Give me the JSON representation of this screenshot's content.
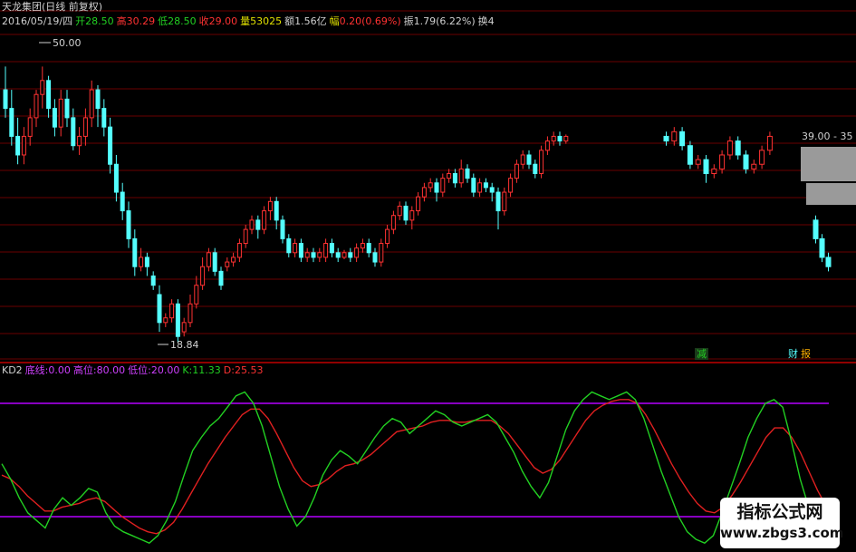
{
  "header": {
    "title": "天龙集团(日线 前复权)",
    "date": "2016/05/19/四",
    "open_label": "开",
    "open": "28.50",
    "high_label": "高",
    "high": "30.29",
    "low_label": "低",
    "low": "28.50",
    "close_label": "收",
    "close": "29.00",
    "vol_label": "量",
    "vol": "53025",
    "amount_label": "额",
    "amount": "1.56亿",
    "change_label": "幅",
    "change": "0.20(0.69%)",
    "amp_label": "振",
    "amp": "1.79(6.22%)",
    "turnover_label": "换",
    "turnover": "4"
  },
  "annotations": {
    "high_mark": "50.00",
    "low_mark": "18.84",
    "range_label": "39.00 - 35",
    "reduce_tag": "减",
    "finance_tag": "财",
    "report_tag": "报"
  },
  "indicator": {
    "name": "KD2",
    "bottom_label": "底线:",
    "bottom": "0.00",
    "top_label": "高位:",
    "top": "80.00",
    "lowpos_label": "低位:",
    "lowpos": "20.00",
    "k_label": "K:",
    "k": "11.33",
    "d_label": "D:",
    "d": "25.53"
  },
  "watermark": {
    "line1": "指标公式网",
    "line2": "www.zbgs3.com"
  },
  "colors": {
    "up": "#ff3232",
    "down": "#54ffff",
    "k_line": "#22d022",
    "d_line": "#e02020",
    "band": "#b400ff",
    "grid": "#6a0000",
    "axis": "#c00000"
  },
  "chart_data": {
    "type": "candlestick",
    "price_high": 50.0,
    "price_low": 18.84,
    "price_range_hint": "39.00 - 35",
    "candles": [
      [
        46,
        44,
        48.5,
        43
      ],
      [
        44,
        41,
        46,
        40
      ],
      [
        41,
        39,
        43,
        38
      ],
      [
        39,
        41,
        42,
        38
      ],
      [
        41,
        43,
        44,
        40
      ],
      [
        43,
        45.5,
        46,
        42
      ],
      [
        45.5,
        47,
        48.5,
        44
      ],
      [
        47,
        44,
        47.5,
        43
      ],
      [
        44,
        42,
        45,
        41
      ],
      [
        42,
        45,
        46,
        41
      ],
      [
        45,
        43,
        46,
        42
      ],
      [
        43,
        40,
        44,
        39.5
      ],
      [
        40,
        41,
        42,
        39
      ],
      [
        41,
        43,
        44,
        40
      ],
      [
        43,
        46,
        47,
        42
      ],
      [
        46,
        44,
        46.5,
        42
      ],
      [
        44,
        42,
        45,
        41
      ],
      [
        42,
        38,
        43,
        37
      ],
      [
        38,
        35,
        39,
        34
      ],
      [
        35,
        33,
        36,
        32
      ],
      [
        33,
        30,
        34,
        29
      ],
      [
        30,
        27,
        31,
        26
      ],
      [
        27,
        28,
        29,
        26.5
      ],
      [
        28,
        27,
        28.5,
        26
      ],
      [
        26,
        25,
        26.5,
        24.5
      ],
      [
        24,
        21,
        25,
        20
      ],
      [
        21,
        21.5,
        22,
        20.5
      ],
      [
        21.5,
        23,
        23.5,
        21
      ],
      [
        23,
        19.5,
        23.5,
        18.84
      ],
      [
        20,
        21,
        21.5,
        19.5
      ],
      [
        21,
        23,
        24,
        20.5
      ],
      [
        23,
        25,
        26,
        22.5
      ],
      [
        25,
        27,
        28,
        24.5
      ],
      [
        27,
        28.5,
        29,
        26.5
      ],
      [
        28.5,
        26.5,
        29,
        26
      ],
      [
        26.5,
        25,
        27,
        24.5
      ],
      [
        27,
        27.5,
        28,
        26.5
      ],
      [
        27.5,
        28,
        28.5,
        27
      ],
      [
        28,
        29.5,
        30,
        27.5
      ],
      [
        29.5,
        31,
        31.5,
        29
      ],
      [
        31,
        32,
        32.5,
        30.5
      ],
      [
        32,
        31,
        32.5,
        30
      ],
      [
        31,
        33,
        33.5,
        30.5
      ],
      [
        33,
        34,
        34.5,
        32
      ],
      [
        34,
        32,
        34.5,
        31
      ],
      [
        32,
        30,
        32.5,
        29.5
      ],
      [
        30,
        28.5,
        30.5,
        28
      ],
      [
        28.5,
        29.5,
        30,
        28
      ],
      [
        29.5,
        28,
        30,
        27.5
      ],
      [
        28,
        28.5,
        29,
        27.5
      ],
      [
        28.5,
        28,
        29,
        27.5
      ],
      [
        28,
        28.5,
        29,
        27.5
      ],
      [
        28,
        29.5,
        30,
        27.5
      ],
      [
        29.5,
        28.5,
        30,
        28
      ],
      [
        28.5,
        28,
        29,
        27.5
      ],
      [
        28,
        28.5,
        28.8,
        27.8
      ],
      [
        28.5,
        28,
        29,
        27.5
      ],
      [
        28,
        29,
        29.5,
        27.5
      ],
      [
        29,
        29.5,
        30,
        28.5
      ],
      [
        29.5,
        28.5,
        30,
        28
      ],
      [
        28.5,
        27.5,
        29,
        27
      ],
      [
        27.5,
        29.5,
        30,
        27
      ],
      [
        29.5,
        31,
        31.5,
        29
      ],
      [
        31,
        32.5,
        33,
        30.5
      ],
      [
        32.5,
        33.5,
        34,
        32
      ],
      [
        33.5,
        32,
        34,
        31.5
      ],
      [
        32,
        33,
        33.5,
        31
      ],
      [
        33,
        34.5,
        35,
        32.5
      ],
      [
        34.5,
        35.5,
        36,
        34
      ],
      [
        35.5,
        36,
        36.5,
        35
      ],
      [
        36,
        35,
        36.5,
        34
      ],
      [
        35,
        36.5,
        37,
        34.5
      ],
      [
        36.5,
        37,
        37.5,
        36
      ],
      [
        37,
        36,
        37.5,
        35.5
      ],
      [
        36,
        37.5,
        38.5,
        35.5
      ],
      [
        37.5,
        36.5,
        38,
        36
      ],
      [
        36.5,
        35,
        37,
        34.5
      ],
      [
        35,
        36,
        36.5,
        34.5
      ],
      [
        36,
        35.5,
        36.5,
        35
      ],
      [
        35.5,
        35,
        36,
        34
      ],
      [
        35,
        33,
        35.5,
        31
      ],
      [
        33,
        35,
        35.5,
        32.5
      ],
      [
        35,
        36.5,
        37,
        34.5
      ],
      [
        36.5,
        38,
        38.5,
        36
      ],
      [
        38,
        39,
        39.5,
        37.5
      ],
      [
        39,
        38,
        39.5,
        37.5
      ],
      [
        38,
        37,
        38.5,
        36.5
      ],
      [
        37,
        39.5,
        40,
        36.5
      ],
      [
        39.5,
        40.5,
        41,
        39
      ],
      [
        40.5,
        41,
        41.5,
        40
      ],
      [
        41,
        40.5,
        41.5,
        40
      ],
      [
        40.5,
        41,
        41.2,
        40.2
      ]
    ],
    "candles_right": [
      [
        41,
        40.5,
        41.5,
        40
      ],
      [
        40.5,
        41.5,
        42,
        40
      ],
      [
        41.5,
        40,
        42,
        39.5
      ],
      [
        40,
        38,
        40.5,
        37.5
      ],
      [
        38,
        38.5,
        39,
        37.5
      ],
      [
        38.5,
        37,
        39,
        36
      ],
      [
        37,
        37.5,
        38,
        36.5
      ],
      [
        37.5,
        39,
        39.5,
        37
      ],
      [
        39,
        40.5,
        41,
        38.5
      ],
      [
        40.5,
        39,
        41,
        38.5
      ],
      [
        39,
        37.5,
        39.5,
        37
      ],
      [
        37.5,
        38,
        38.5,
        37
      ],
      [
        38,
        39.5,
        40,
        37.5
      ],
      [
        39.5,
        41,
        41.5,
        39
      ]
    ],
    "candles_far_right": [
      [
        32,
        30,
        32.5,
        29.5
      ],
      [
        30,
        28,
        30.5,
        27.5
      ],
      [
        28,
        27,
        28.5,
        26.5
      ]
    ],
    "kd": {
      "name": "KD2",
      "levels": {
        "bottom": 0.0,
        "top": 80.0,
        "low": 20.0
      },
      "current": {
        "K": 11.33,
        "D": 25.53
      },
      "k_series": [
        48,
        40,
        30,
        22,
        18,
        14,
        24,
        30,
        26,
        30,
        35,
        33,
        22,
        15,
        12,
        10,
        8,
        6,
        10,
        18,
        28,
        42,
        55,
        62,
        68,
        72,
        78,
        84,
        86,
        80,
        68,
        52,
        36,
        24,
        15,
        20,
        30,
        42,
        50,
        55,
        52,
        48,
        55,
        62,
        68,
        72,
        70,
        64,
        68,
        72,
        76,
        74,
        70,
        68,
        70,
        72,
        74,
        70,
        62,
        54,
        44,
        36,
        30,
        38,
        52,
        66,
        76,
        82,
        86,
        84,
        82,
        84,
        86,
        82,
        72,
        58,
        44,
        32,
        20,
        12,
        8,
        6,
        10,
        22,
        35,
        48,
        62,
        72,
        80,
        82,
        78,
        60,
        40,
        25,
        15,
        11
      ],
      "d_series": [
        42,
        40,
        36,
        31,
        27,
        23,
        23,
        25,
        26,
        27,
        29,
        30,
        28,
        24,
        20,
        17,
        14,
        12,
        11,
        13,
        17,
        24,
        32,
        40,
        48,
        55,
        62,
        68,
        74,
        77,
        77,
        72,
        64,
        55,
        46,
        39,
        36,
        37,
        40,
        44,
        47,
        48,
        50,
        53,
        57,
        61,
        65,
        66,
        67,
        68,
        70,
        71,
        71,
        70,
        70,
        71,
        71,
        71,
        68,
        64,
        58,
        52,
        46,
        43,
        45,
        50,
        57,
        64,
        71,
        76,
        79,
        81,
        82,
        82,
        80,
        74,
        66,
        57,
        48,
        40,
        33,
        27,
        23,
        22,
        25,
        31,
        38,
        46,
        54,
        62,
        67,
        67,
        62,
        54,
        44,
        34,
        25.53
      ]
    }
  }
}
